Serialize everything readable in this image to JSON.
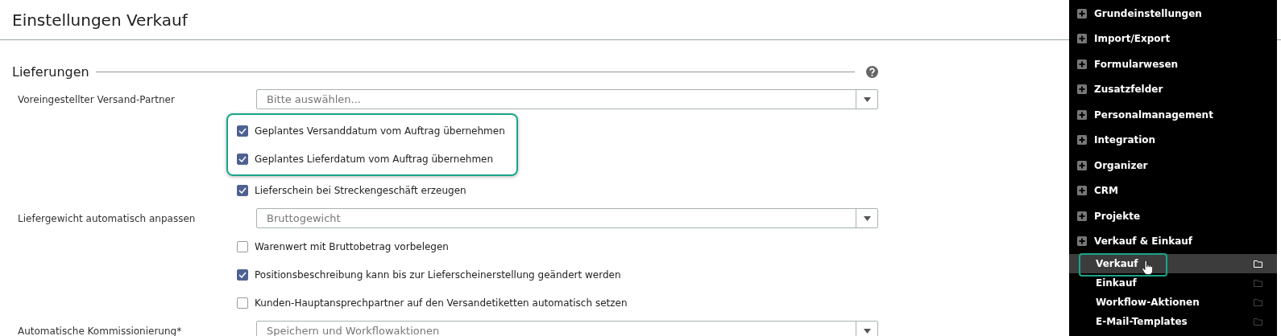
{
  "page": {
    "title": "Einstellungen Verkauf"
  },
  "section": {
    "title": "Lieferungen",
    "rows": [
      {
        "kind": "select",
        "label": "Voreingestellter Versand-Partner",
        "value": "Bitte auswählen..."
      },
      {
        "kind": "checkbox",
        "label": "Geplantes Versanddatum vom Auftrag übernehmen",
        "checked": true,
        "highlighted": true
      },
      {
        "kind": "checkbox",
        "label": "Geplantes Lieferdatum vom Auftrag übernehmen",
        "checked": true,
        "highlighted": true
      },
      {
        "kind": "checkbox",
        "label": "Lieferschein bei Streckengeschäft erzeugen",
        "checked": true,
        "highlighted": false
      },
      {
        "kind": "select",
        "label": "Liefergewicht automatisch anpassen",
        "value": "Bruttogewicht"
      },
      {
        "kind": "checkbox",
        "label": "Warenwert mit Bruttobetrag vorbelegen",
        "checked": false,
        "highlighted": false
      },
      {
        "kind": "checkbox",
        "label": "Positionsbeschreibung kann bis zur Lieferscheinerstellung geändert werden",
        "checked": true,
        "highlighted": false
      },
      {
        "kind": "checkbox",
        "label": "Kunden-Hauptansprechpartner auf den Versandetiketten automatisch setzen",
        "checked": false,
        "highlighted": false
      },
      {
        "kind": "select",
        "label": "Automatische Kommissionierung*",
        "value": "Speichern und Workflowaktionen"
      }
    ]
  },
  "sidebar": {
    "items": [
      {
        "label": "Grundeinstellungen"
      },
      {
        "label": "Import/Export"
      },
      {
        "label": "Formularwesen"
      },
      {
        "label": "Zusatzfelder"
      },
      {
        "label": "Personalmanagement"
      },
      {
        "label": "Integration"
      },
      {
        "label": "Organizer"
      },
      {
        "label": "CRM"
      },
      {
        "label": "Projekte"
      },
      {
        "label": "Verkauf & Einkauf",
        "children": [
          {
            "label": "Verkauf",
            "selected": true,
            "highlighted": true
          },
          {
            "label": "Einkauf",
            "selected": false,
            "highlighted": false
          },
          {
            "label": "Workflow-Aktionen",
            "selected": false,
            "highlighted": false
          },
          {
            "label": "E-Mail-Templates",
            "selected": false,
            "highlighted": false
          }
        ]
      }
    ]
  }
}
